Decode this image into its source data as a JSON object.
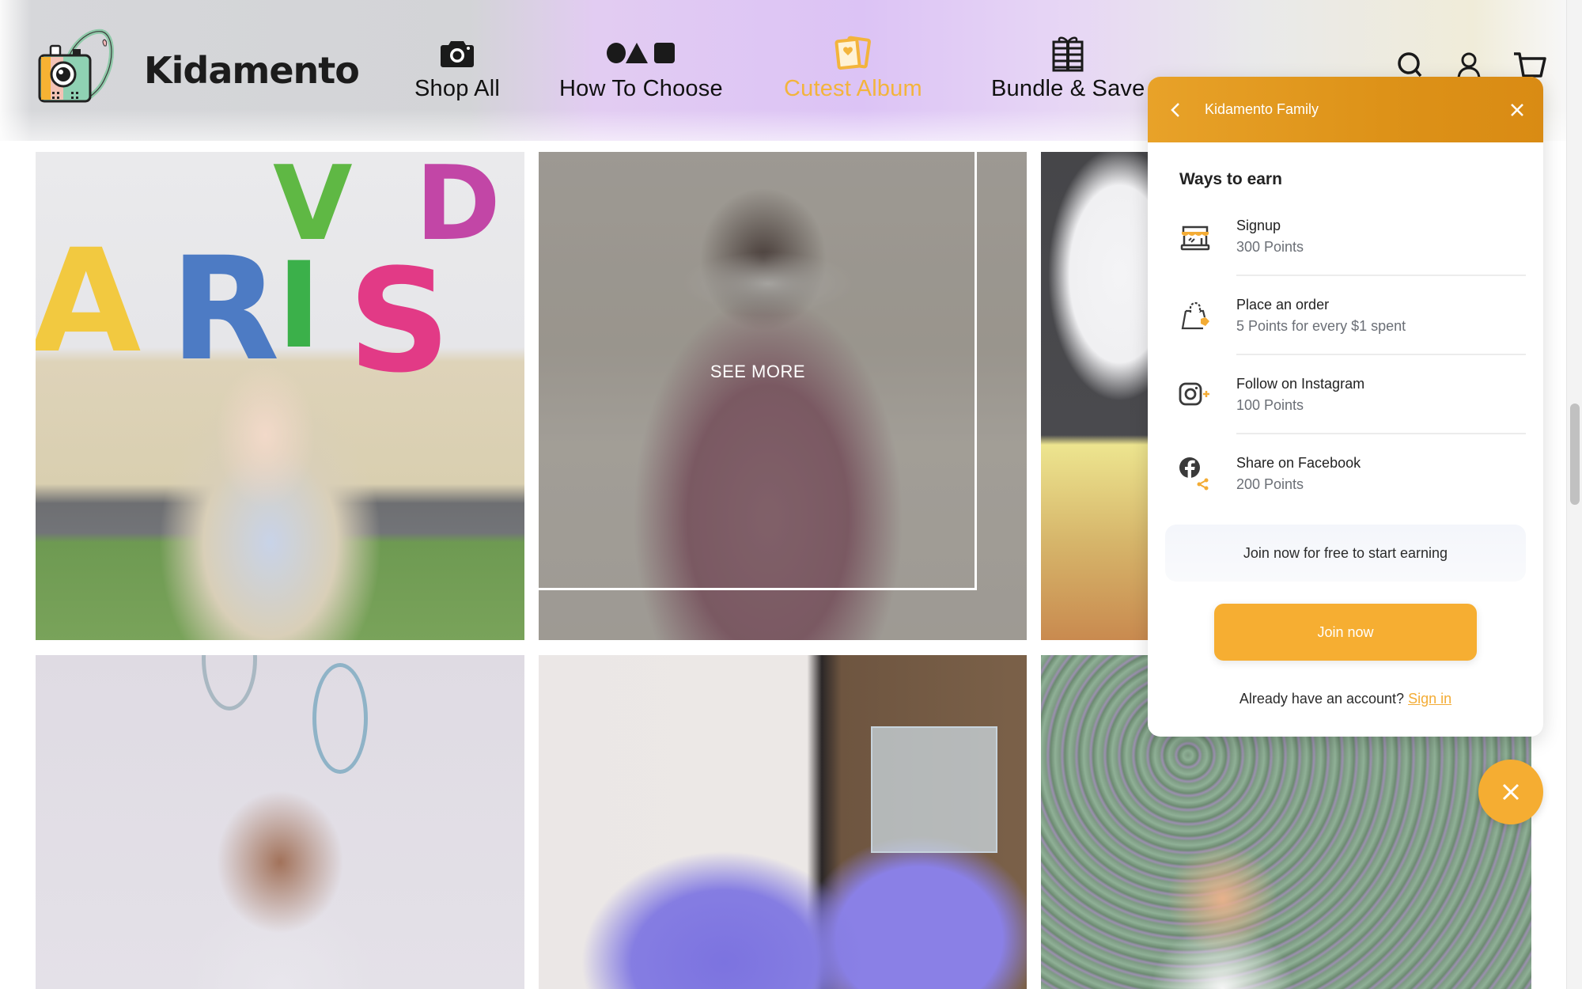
{
  "brand": {
    "name": "Kidamento",
    "logo_icon": "camera-mascot-logo"
  },
  "nav": {
    "items": [
      {
        "label": "Shop All",
        "icon": "camera-icon",
        "active": false
      },
      {
        "label": "How To Choose",
        "icon": "shapes-icon",
        "active": false
      },
      {
        "label": "Cutest Album",
        "icon": "photo-album-icon",
        "active": true
      },
      {
        "label": "Bundle & Save",
        "icon": "gift-icon",
        "active": false
      }
    ],
    "active_color": "#f3b43c"
  },
  "header_icons": [
    "search-icon",
    "account-icon",
    "cart-icon"
  ],
  "gallery": {
    "see_more_label": "SEE MORE",
    "tiles": [
      {
        "description": "Girl in sparkly dress in front of colorful letters"
      },
      {
        "description": "Girl holding panda camera",
        "hover": true
      },
      {
        "description": "White camera on dark leather"
      },
      {
        "description": "Child with blue camera against wall with rope balloons"
      },
      {
        "description": "Purple unicorn camera next to basket and diffuser"
      },
      {
        "description": "Boy in front of leaf wall"
      }
    ]
  },
  "loyalty_panel": {
    "title": "Kidamento Family",
    "back_icon": "chevron-left-icon",
    "close_icon": "close-icon",
    "section_title": "Ways to earn",
    "ways_to_earn": [
      {
        "name": "Signup",
        "points": "300 Points",
        "icon": "storefront-icon"
      },
      {
        "name": "Place an order",
        "points": "5 Points for every $1 spent",
        "icon": "shopping-bag-icon"
      },
      {
        "name": "Follow on Instagram",
        "points": "100 Points",
        "icon": "instagram-icon"
      },
      {
        "name": "Share on Facebook",
        "points": "200 Points",
        "icon": "facebook-share-icon"
      }
    ],
    "join_hint": "Join now for free to start earning",
    "join_button": "Join now",
    "signin_prompt": "Already have an account?",
    "signin_link": "Sign in",
    "accent_color": "#f6ae32",
    "header_color": "#dd9218"
  },
  "launcher": {
    "close_icon": "close-icon"
  }
}
